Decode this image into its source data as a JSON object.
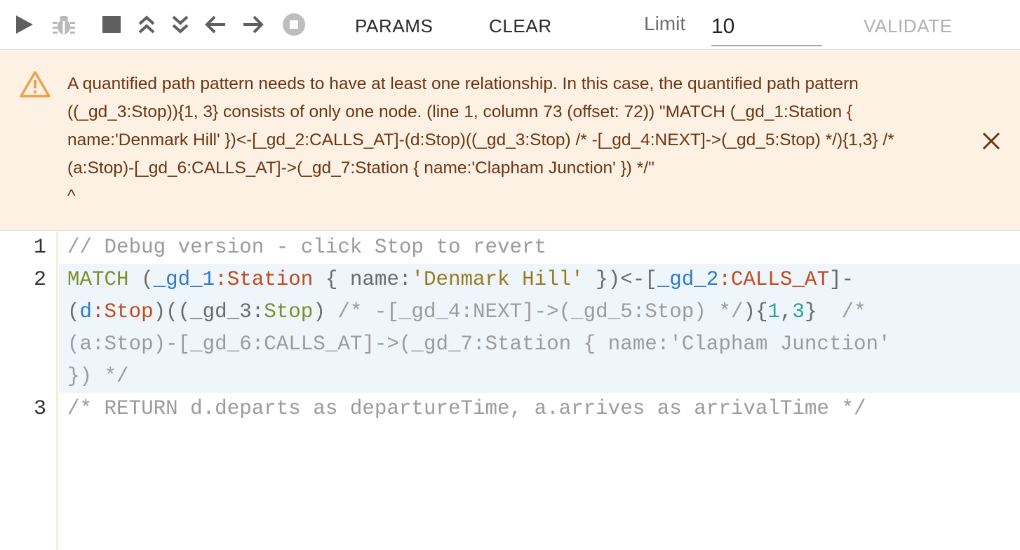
{
  "toolbar": {
    "params_label": "PARAMS",
    "clear_label": "CLEAR",
    "limit_label": "Limit",
    "limit_value": "10",
    "validate_label": "VALIDATE",
    "icons": [
      "play-icon",
      "debug-icon",
      "stop-icon",
      "step-up-icon",
      "step-down-icon",
      "arrow-left-icon",
      "arrow-right-icon",
      "stop-circle-icon"
    ]
  },
  "error": {
    "message": "A quantified path pattern needs to have at least one relationship. In this case, the quantified path pattern ((_gd_3:Stop)){1, 3} consists of only one node. (line 1, column 73 (offset: 72)) \"MATCH (_gd_1:Station { name:'Denmark Hill' })<-[_gd_2:CALLS_AT]-(d:Stop)((_gd_3:Stop) /* -[_gd_4:NEXT]->(_gd_5:Stop) */){1,3} /* (a:Stop)-[_gd_6:CALLS_AT]->(_gd_7:Station { name:'Clapham Junction' }) */\"\n^",
    "background": "#fdf1e4",
    "text_color": "#6b3512",
    "icon_color": "#f0a04b"
  },
  "editor": {
    "line_numbers": [
      "1",
      "2",
      "3"
    ],
    "line1": "// Debug version - click Stop to revert",
    "line2": {
      "kw_match": "MATCH",
      "p1": " (",
      "v1": "_gd_1",
      "c1": ":",
      "l1": "Station",
      "p2": " { name:",
      "s1": "'Denmark Hill'",
      "p3": " })<-[",
      "v2": "_gd_2",
      "c2": ":",
      "l2": "CALLS_AT",
      "p4": "]-",
      "p5": "(",
      "v3": "d",
      "c3": ":",
      "l3": "Stop",
      "p6": ")((_gd_3:",
      "k1": "Stop",
      "p7": ") ",
      "cm1": "/* -[_gd_4:NEXT]->(_gd_5:Stop) */",
      "p8": "){",
      "n1": "1",
      "p9": ",",
      "n2": "3",
      "p10": "}  ",
      "cm2": "/*",
      "cm3": "(a:Stop)-[_gd_6:CALLS_AT]->(_gd_7:Station { name:'Clapham Junction'",
      "cm4": "}) */"
    },
    "line3": "/* RETURN d.departs as departureTime, a.arrives as arrivalTime */"
  }
}
